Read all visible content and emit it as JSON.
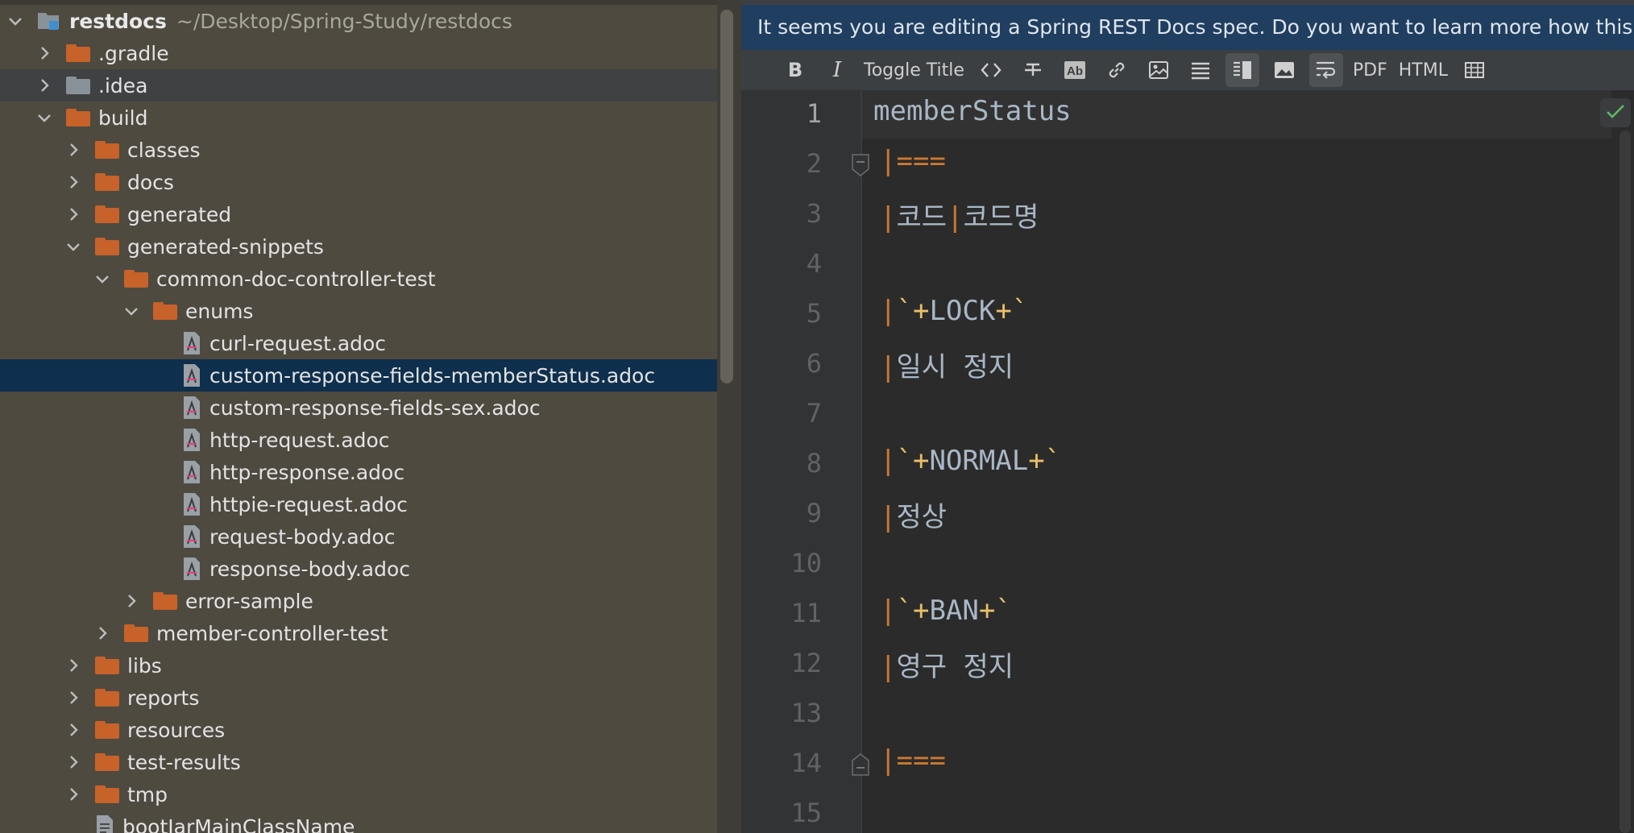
{
  "project": {
    "root_name": "restdocs",
    "root_path": "~/Desktop/Spring-Study/restdocs",
    "items": [
      {
        "label": ".gradle"
      },
      {
        "label": ".idea"
      },
      {
        "label": "build"
      },
      {
        "label": "classes"
      },
      {
        "label": "docs"
      },
      {
        "label": "generated"
      },
      {
        "label": "generated-snippets"
      },
      {
        "label": "common-doc-controller-test"
      },
      {
        "label": "enums"
      },
      {
        "label": "curl-request.adoc"
      },
      {
        "label": "custom-response-fields-memberStatus.adoc"
      },
      {
        "label": "custom-response-fields-sex.adoc"
      },
      {
        "label": "http-request.adoc"
      },
      {
        "label": "http-response.adoc"
      },
      {
        "label": "httpie-request.adoc"
      },
      {
        "label": "request-body.adoc"
      },
      {
        "label": "response-body.adoc"
      },
      {
        "label": "error-sample"
      },
      {
        "label": "member-controller-test"
      },
      {
        "label": "libs"
      },
      {
        "label": "reports"
      },
      {
        "label": "resources"
      },
      {
        "label": "test-results"
      },
      {
        "label": "tmp"
      },
      {
        "label": "bootJarMainClassName"
      }
    ]
  },
  "editor": {
    "banner": "It seems you are editing a Spring REST Docs spec. Do you want to learn more how this p",
    "toolbar": {
      "bold": "B",
      "italic": "I",
      "toggle_title": "Toggle Title",
      "pdf": "PDF",
      "html": "HTML"
    },
    "lines": [
      {
        "n": "1"
      },
      {
        "n": "2"
      },
      {
        "n": "3"
      },
      {
        "n": "4"
      },
      {
        "n": "5"
      },
      {
        "n": "6"
      },
      {
        "n": "7"
      },
      {
        "n": "8"
      },
      {
        "n": "9"
      },
      {
        "n": "10"
      },
      {
        "n": "11"
      },
      {
        "n": "12"
      },
      {
        "n": "13"
      },
      {
        "n": "14"
      },
      {
        "n": "15"
      }
    ],
    "code": {
      "l1": "memberStatus",
      "bar": "|",
      "eq": "===",
      "l3a": "코드",
      "l3b": "코드명",
      "bt": "`",
      "plus": "+",
      "lock": "LOCK",
      "l6": "일시 정지",
      "normal": "NORMAL",
      "l9": "정상",
      "ban": "BAN",
      "l12": "영구 정지"
    }
  },
  "colors": {
    "tree_bg": "#4e4a40",
    "selected_row": "#0e2f4d",
    "folder_orange": "#c7622a",
    "folder_grey": "#8a9299",
    "banner_bg": "#203e5f",
    "editor_bg": "#2b2b2b",
    "keyword_orange": "#cc7832",
    "backtick_yellow": "#e8bf6a",
    "text": "#a9b7c6"
  },
  "icons": [
    "chevron-right-icon",
    "chevron-down-icon",
    "folder-icon",
    "asciidoc-file-icon",
    "bold-icon",
    "italic-icon",
    "code-icon",
    "strikethrough-icon",
    "highlight-icon",
    "link-icon",
    "image-icon",
    "list-icon",
    "editor-preview-icon",
    "picture-icon",
    "soft-wrap-icon",
    "table-icon",
    "check-icon",
    "fold-icon"
  ]
}
